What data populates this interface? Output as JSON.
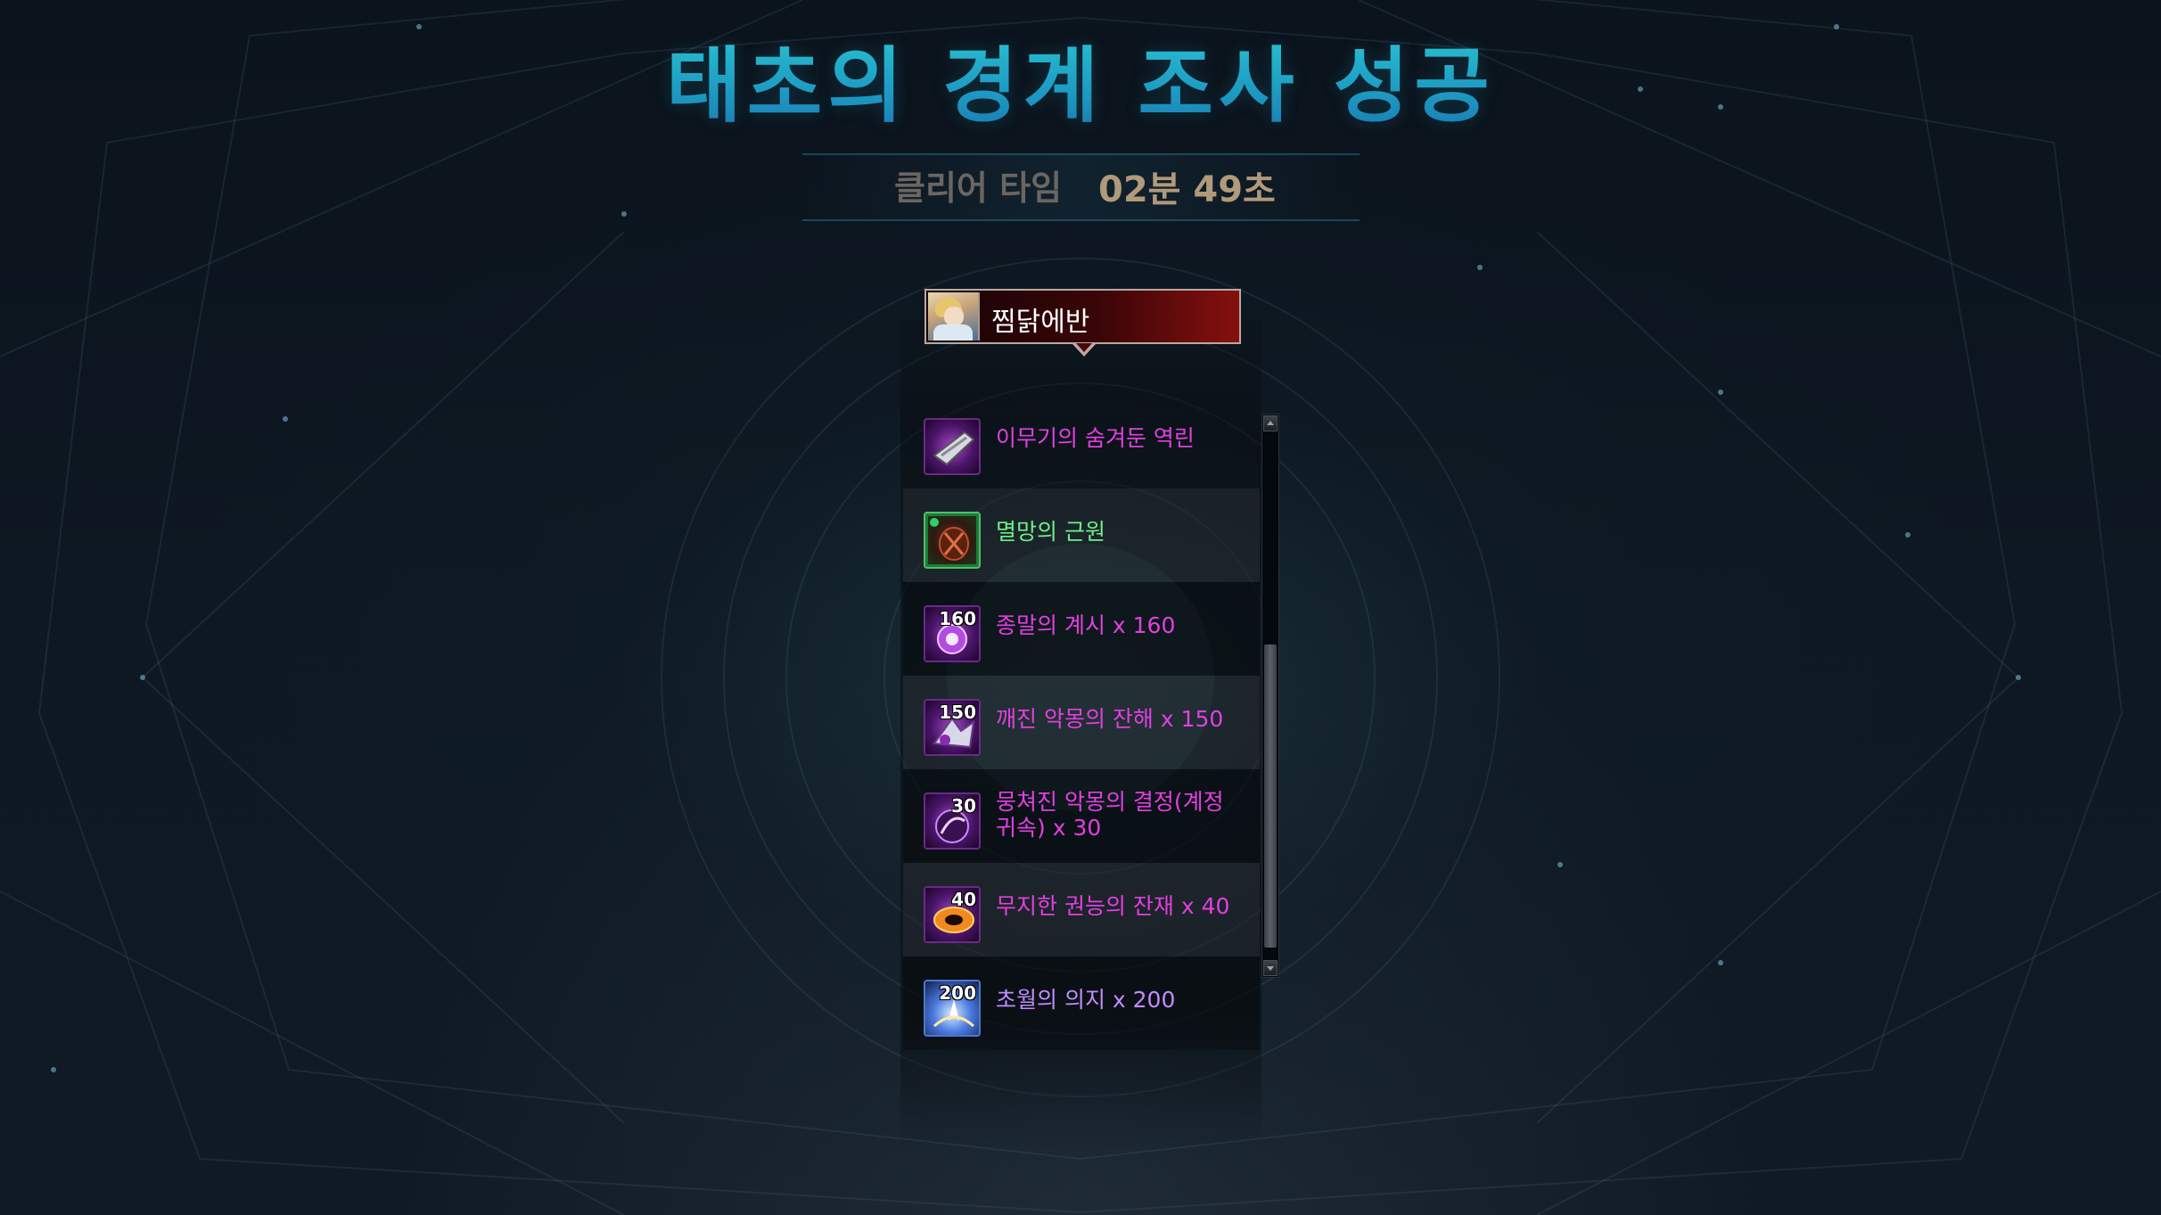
{
  "title": "태초의 경계 조사 성공",
  "clear_time": {
    "label": "클리어 타임",
    "value": "02분 49초"
  },
  "player": {
    "name": "찜닭에반"
  },
  "rewards": [
    {
      "name": "이무기의 숨겨둔 역린",
      "count": "",
      "color": "#e23fe0",
      "icon": "reverse-scale-icon"
    },
    {
      "name": "멸망의 근원",
      "count": "",
      "color": "#6ef08a",
      "icon": "destruction-source-icon"
    },
    {
      "name": "종말의 계시 x 160",
      "count": "160",
      "color": "#e23fe0",
      "icon": "revelation-orb-icon"
    },
    {
      "name": "깨진 악몽의 잔해 x 150",
      "count": "150",
      "color": "#e23fe0",
      "icon": "nightmare-debris-icon"
    },
    {
      "name": "뭉쳐진 악몽의 결정(계정 귀속) x 30",
      "count": "30",
      "color": "#e23fe0",
      "icon": "nightmare-crystal-icon"
    },
    {
      "name": "무지한 권능의 잔재 x 40",
      "count": "40",
      "color": "#e23fe0",
      "icon": "power-remnant-icon"
    },
    {
      "name": "초월의 의지 x 200",
      "count": "200",
      "color": "#c08cff",
      "icon": "transcendence-will-icon"
    }
  ]
}
